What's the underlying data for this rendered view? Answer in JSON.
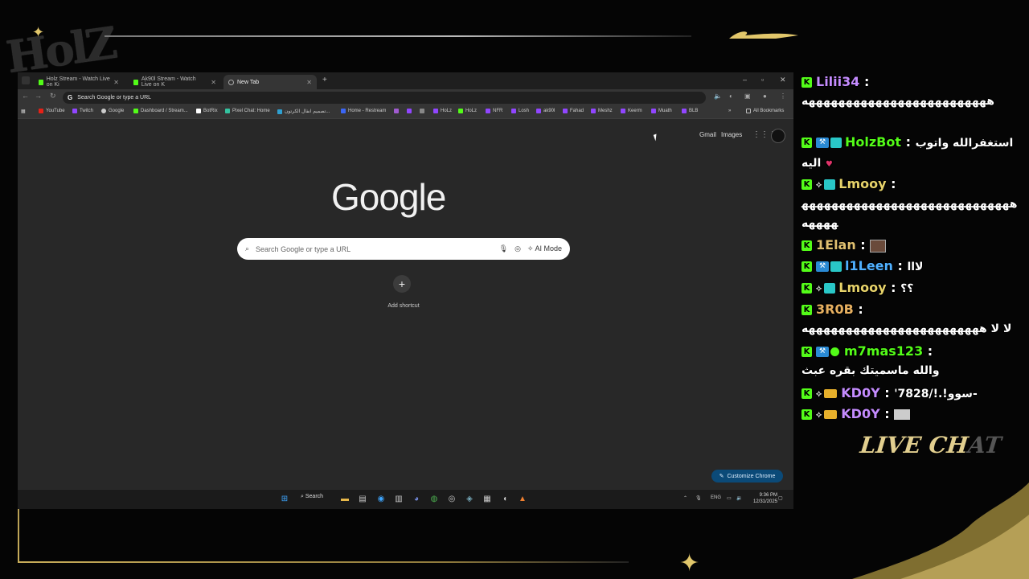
{
  "overlay": {
    "logo_text": "HolZ",
    "live_chat_label": "LIVE CH",
    "live_chat_faded": "AT"
  },
  "browser": {
    "tabs": [
      {
        "label": "Holz Stream - Watch Live on Ki",
        "favicon": "kick-icon"
      },
      {
        "label": "Ak90l Stream - Watch Live on K",
        "favicon": "kick-icon"
      },
      {
        "label": "New Tab",
        "favicon": "globe-icon",
        "active": true
      }
    ],
    "new_tab_symbol": "+",
    "omnibox_placeholder": "Search Google or type a URL",
    "bookmarks": [
      {
        "label": "YouTube",
        "color": "#e62117"
      },
      {
        "label": "Twitch",
        "color": "#9146ff"
      },
      {
        "label": "Google",
        "color": "#cccccc"
      },
      {
        "label": "Dashboard / Stream...",
        "color": "#53fc18"
      },
      {
        "label": "BotRix",
        "color": "#ffffff"
      },
      {
        "label": "Pixel Chat: Home",
        "color": "#34c3a0"
      },
      {
        "label": "تصميم انفال الكرتون...",
        "color": "#2fa0d0"
      },
      {
        "label": "Home - Restream",
        "color": "#3b66f5"
      },
      {
        "label": "",
        "color": "#a05bd0"
      },
      {
        "label": "",
        "color": "#888888"
      },
      {
        "label": "HoLz",
        "color": "#9146ff"
      },
      {
        "label": "HoLz",
        "color": "#53fc18"
      },
      {
        "label": "NFR",
        "color": "#9146ff"
      },
      {
        "label": "Losh",
        "color": "#9146ff"
      },
      {
        "label": "ak90l",
        "color": "#9146ff"
      },
      {
        "label": "Fahad",
        "color": "#9146ff"
      },
      {
        "label": "Meshz",
        "color": "#9146ff"
      },
      {
        "label": "Keerm",
        "color": "#9146ff"
      },
      {
        "label": "Muath",
        "color": "#9146ff"
      },
      {
        "label": "BLB",
        "color": "#9146ff"
      }
    ],
    "more_bookmarks": "»",
    "all_bookmarks": "All Bookmarks",
    "header_links": {
      "gmail": "Gmail",
      "images": "Images"
    },
    "google_logo": "Google",
    "search_placeholder": "Search Google or type a URL",
    "ai_mode": "AI Mode",
    "add_shortcut_symbol": "+",
    "add_shortcut_label": "Add shortcut",
    "customize_label": "Customize Chrome"
  },
  "taskbar": {
    "search_label": "Search",
    "lang": "ENG",
    "time": "9:36 PM",
    "date": "12/31/2025"
  },
  "chat": [
    {
      "user": "Lilii34",
      "color": "#c58cff",
      "sep": " :",
      "text": "هههههههههههههههههههههههههه"
    },
    {
      "user": "HolzBot",
      "color": "#53fc18",
      "sep": " :",
      "text": "استغفرالله واتوب اليه"
    },
    {
      "user": "Lmooy",
      "color": "#e7d36a",
      "sep": " :",
      "text": "هههههههههههههههههههههههههههههههههه"
    },
    {
      "user": "1Elan",
      "color": "#e0c070",
      "sep": " :",
      "text": ""
    },
    {
      "user": "l1Leen",
      "color": "#4fb0ff",
      "sep": " :",
      "text": "لااا"
    },
    {
      "user": "Lmooy",
      "color": "#e7d36a",
      "sep": " :",
      "text": "؟؟"
    },
    {
      "user": "3R0B",
      "color": "#e7b060",
      "sep": " :",
      "text": "لا لا ههههههههههههههههههههههههه"
    },
    {
      "user": "m7mas123",
      "color": "#53fc18",
      "sep": " :",
      "text": "والله ماسميتك بقره عبث"
    },
    {
      "user": "KD0Y",
      "color": "#c58cff",
      "sep": " :",
      "text": "'7828/!.!سوو-"
    },
    {
      "user": "KD0Y",
      "color": "#c58cff",
      "sep": " :",
      "text": ""
    }
  ]
}
